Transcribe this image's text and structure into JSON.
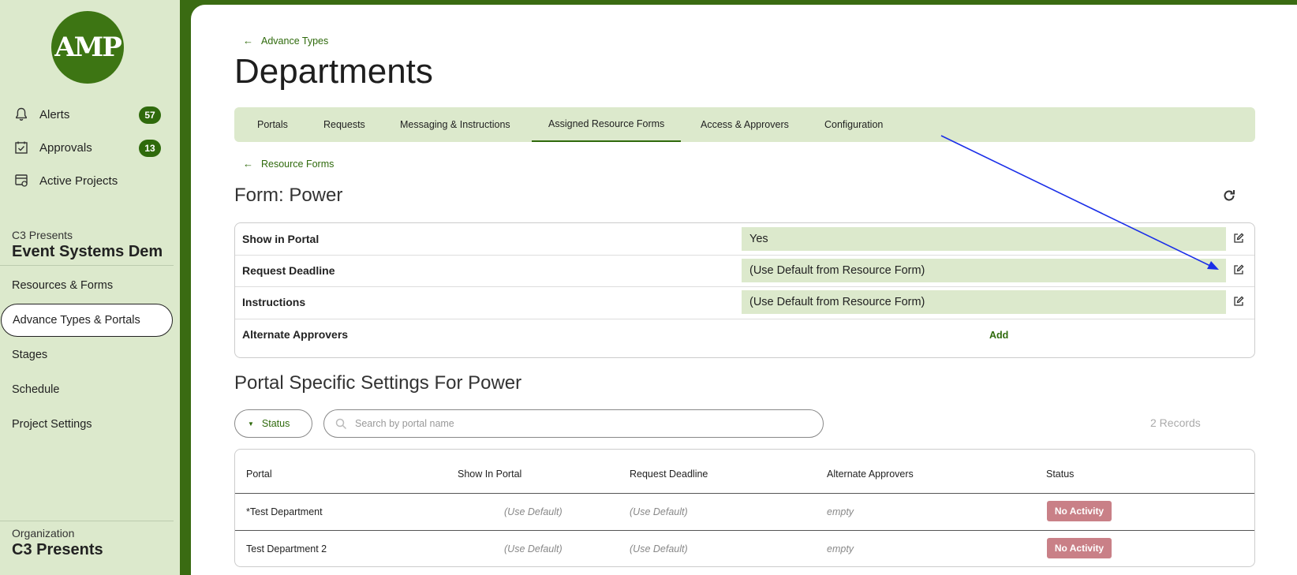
{
  "sidebar": {
    "logo_text": "AMP",
    "alerts": {
      "label": "Alerts",
      "count": "57"
    },
    "approvals": {
      "label": "Approvals",
      "count": "13"
    },
    "active_projects": {
      "label": "Active Projects"
    },
    "project": {
      "org": "C3 Presents",
      "name": "Event Systems Demo"
    },
    "links": [
      "Resources & Forms",
      "Advance Types & Portals",
      "Stages",
      "Schedule",
      "Project Settings"
    ],
    "organization_label": "Organization",
    "organization_name": "C3 Presents"
  },
  "main": {
    "back_link": "Advance Types",
    "title": "Departments",
    "tabs": [
      "Portals",
      "Requests",
      "Messaging & Instructions",
      "Assigned Resource Forms",
      "Access & Approvers",
      "Configuration"
    ],
    "active_tab": "Assigned Resource Forms",
    "sub_back_link": "Resource Forms",
    "form_title": "Form: Power",
    "settings": [
      {
        "label": "Show in Portal",
        "value": "Yes"
      },
      {
        "label": "Request Deadline",
        "value": "(Use Default from Resource Form)"
      },
      {
        "label": "Instructions",
        "value": "(Use Default from Resource Form)"
      },
      {
        "label": "Alternate Approvers",
        "action": "Add"
      }
    ],
    "section_title": "Portal Specific Settings For Power",
    "filter": {
      "status_label": "Status",
      "search_placeholder": "Search by portal name",
      "records": "2 Records"
    },
    "table": {
      "headers": [
        "Portal",
        "Show In Portal",
        "Request Deadline",
        "Alternate Approvers",
        "Status"
      ],
      "rows": [
        {
          "portal": "*Test Department",
          "show": "(Use Default)",
          "deadline": "(Use Default)",
          "approvers": "empty",
          "status": "No Activity"
        },
        {
          "portal": "Test Department 2",
          "show": "(Use Default)",
          "deadline": "(Use Default)",
          "approvers": "empty",
          "status": "No Activity"
        }
      ]
    }
  },
  "colors": {
    "brand_green": "#2f6a0c",
    "light_green": "#dce9cc",
    "status_pill": "#c98087",
    "annotation_arrow": "#1a2ee8"
  },
  "icons": [
    "bell-icon",
    "checkbox-icon",
    "projects-icon",
    "back-arrow-icon",
    "refresh-icon",
    "edit-icon",
    "search-icon",
    "caret-down-icon"
  ]
}
